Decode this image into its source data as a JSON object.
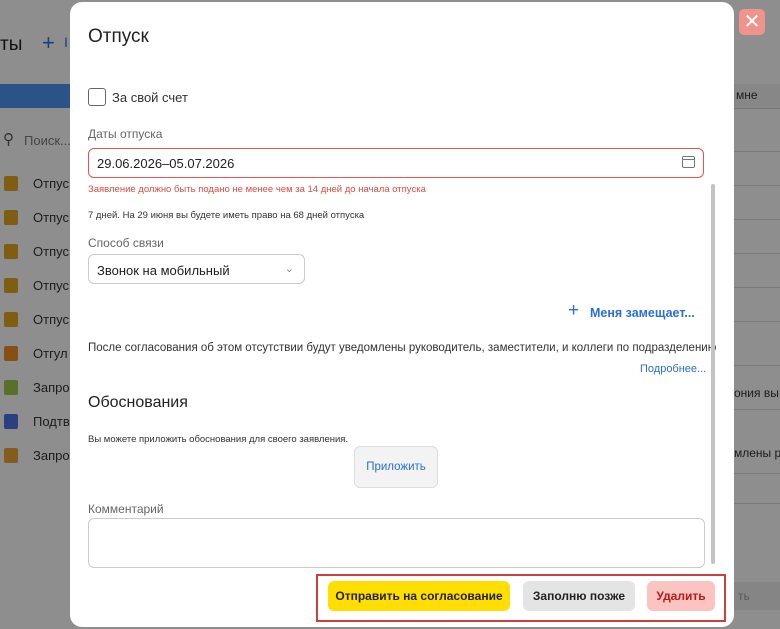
{
  "background": {
    "title": "ты",
    "plus_label": "+",
    "plus_text": "I",
    "search_placeholder": "Поиск...",
    "right_header": "мне",
    "rows": [
      {
        "label": "Отпус",
        "color": "#d9a21f",
        "icon": "suitcase-icon"
      },
      {
        "label": "Отпус",
        "color": "#d9a21f",
        "icon": "suitcase-icon"
      },
      {
        "label": "Отпус",
        "color": "#d9a21f",
        "icon": "suitcase-icon"
      },
      {
        "label": "Отпус",
        "color": "#d9a21f",
        "icon": "suitcase-icon"
      },
      {
        "label": "Отпус",
        "color": "#d9a21f",
        "icon": "suitcase-icon"
      },
      {
        "label": "Отгул",
        "color": "#e58a2a",
        "icon": "calendar-x-icon"
      },
      {
        "label": "Запро",
        "color": "#9bbf4a",
        "icon": "clipboard-icon"
      },
      {
        "label": "Подтв",
        "color": "#4a6fd6",
        "icon": "clipboard-icon"
      },
      {
        "label": "Запро",
        "color": "#e0a030",
        "icon": "clipboard-icon"
      }
    ],
    "right_texts": [
      "ония вы бу",
      "млены ру"
    ],
    "right_button": "ть"
  },
  "modal": {
    "close_icon": "close-icon",
    "title": "Отпуск",
    "self_paid_label": "За свой счет",
    "dates_label": "Даты отпуска",
    "dates_value": "29.06.2026–05.07.2026",
    "dates_error": "Заявление должно быть подано не менее чем за 14 дней до начала отпуска",
    "dates_info": "7 дней. На 29 июня вы будете иметь право на 68 дней отпуска",
    "contact_label": "Способ связи",
    "contact_value": "Звонок на мобильный",
    "substitute_label": "Меня замещает...",
    "notify_text": "После согласования об этом отсутствии будут уведомлены руководитель, заместители, и коллеги по подразделению",
    "more_link": "Подробнее...",
    "justifications_title": "Обоснования",
    "attach_hint": "Вы можете приложить обоснования для своего заявления.",
    "attach_button": "Приложить",
    "comment_label": "Комментарий",
    "comment_value": "",
    "buttons": {
      "submit": "Отправить на согласование",
      "later": "Заполню позже",
      "delete": "Удалить"
    }
  },
  "colors": {
    "accent_blue": "#2a6fd6",
    "error_red": "#e04a42",
    "submit_yellow": "#ffde00",
    "delete_pink": "#fbc4c0"
  }
}
